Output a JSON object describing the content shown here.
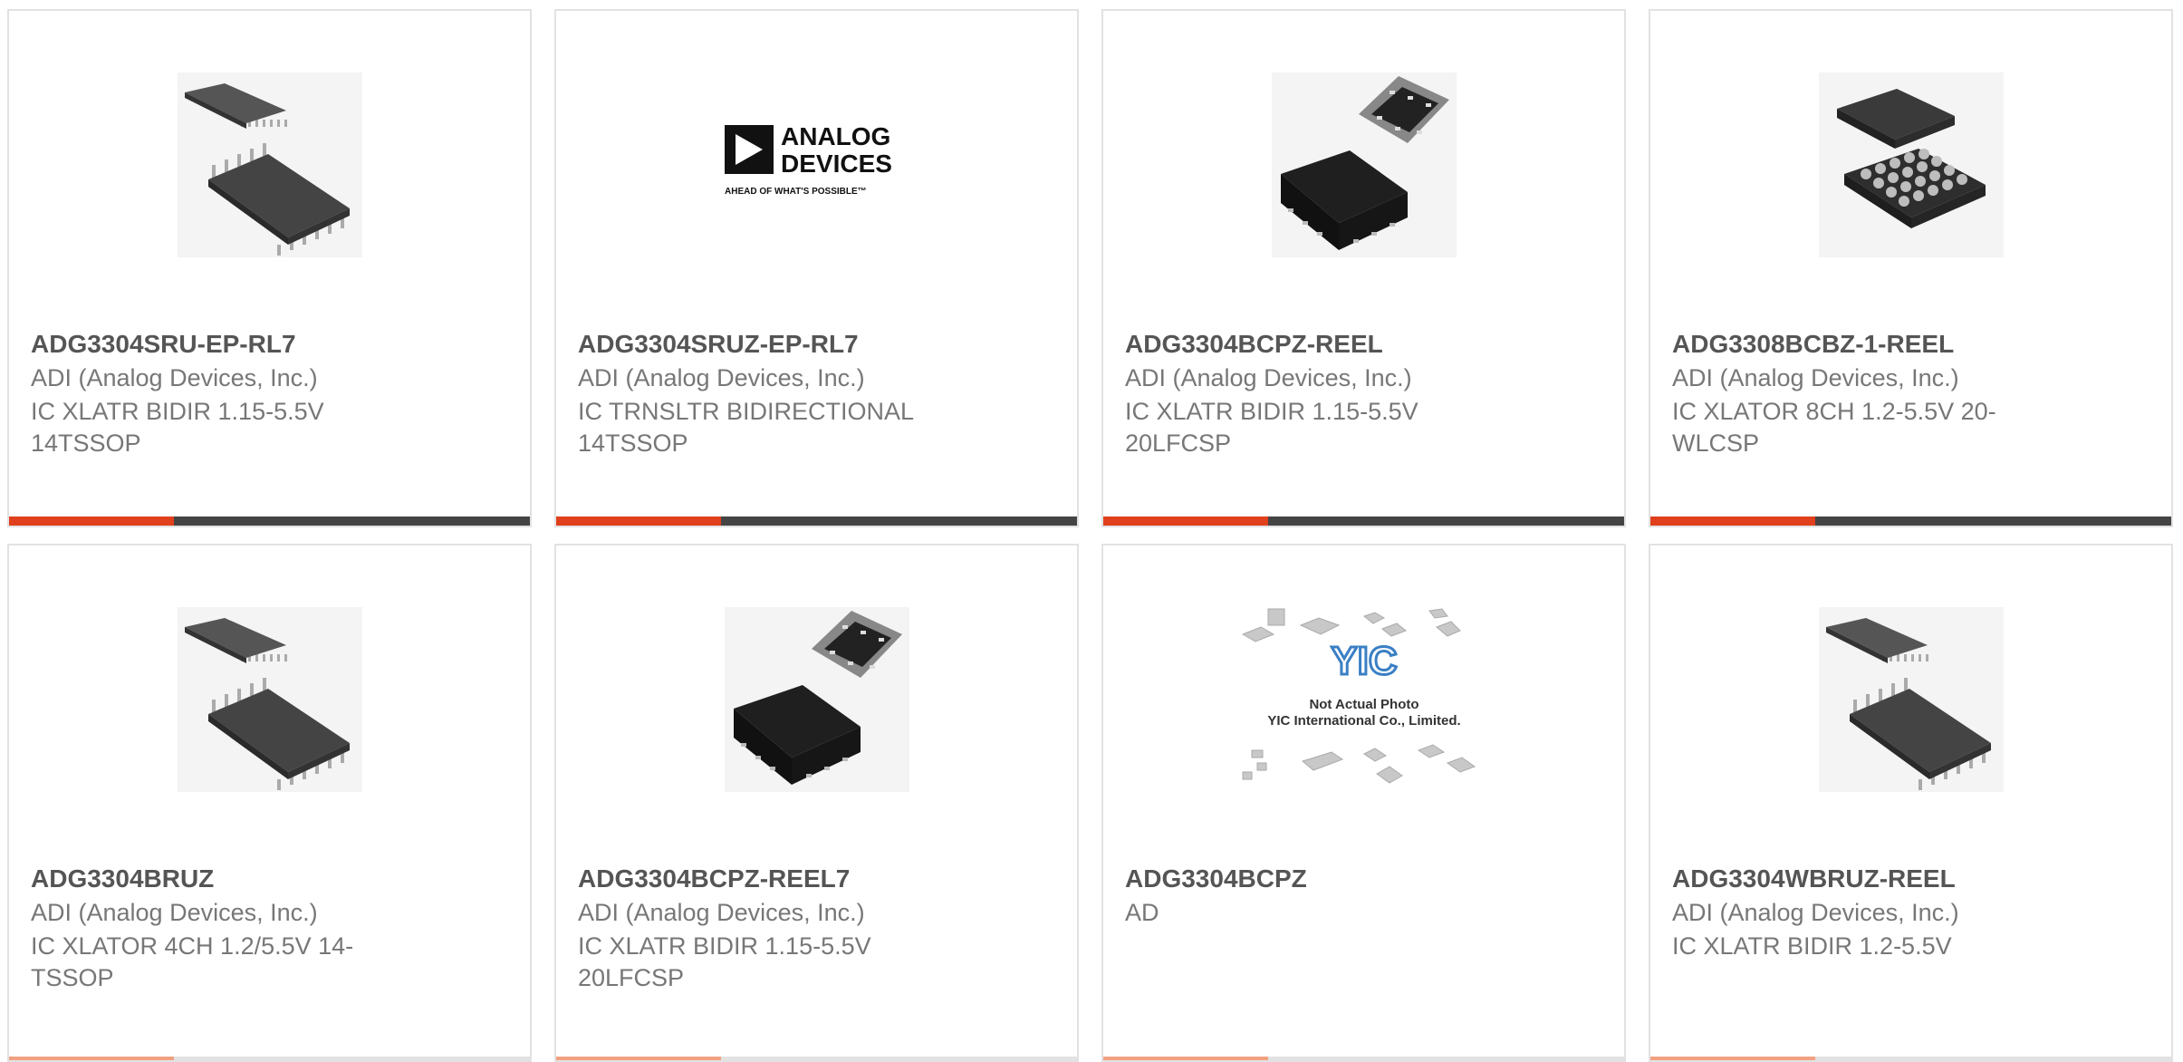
{
  "products": [
    {
      "part": "ADG3304SRU-EP-RL7",
      "manufacturer": "ADI (Analog Devices, Inc.)",
      "description": "IC XLATR BIDIR 1.15-5.5V 14TSSOP",
      "image": "tssop-chip-photo"
    },
    {
      "part": "ADG3304SRUZ-EP-RL7",
      "manufacturer": "ADI (Analog Devices, Inc.)",
      "description": "IC TRNSLTR BIDIRECTIONAL 14TSSOP",
      "image": "analog-devices-logo",
      "logo_text": {
        "line1": "ANALOG",
        "line2": "DEVICES",
        "tagline": "AHEAD OF WHAT'S POSSIBLE™"
      }
    },
    {
      "part": "ADG3304BCPZ-REEL",
      "manufacturer": "ADI (Analog Devices, Inc.)",
      "description": "IC XLATR BIDIR 1.15-5.5V 20LFCSP",
      "image": "lfcsp-chip-photo"
    },
    {
      "part": "ADG3308BCBZ-1-REEL",
      "manufacturer": "ADI (Analog Devices, Inc.)",
      "description": "IC XLATOR 8CH 1.2-5.5V 20-WLCSP",
      "image": "wlcsp-chip-photo"
    },
    {
      "part": "ADG3304BRUZ",
      "manufacturer": "ADI (Analog Devices, Inc.)",
      "description": "IC XLATOR 4CH 1.2/5.5V 14-TSSOP",
      "image": "tssop-chip-photo"
    },
    {
      "part": "ADG3304BCPZ-REEL7",
      "manufacturer": "ADI (Analog Devices, Inc.)",
      "description": "IC XLATR BIDIR 1.15-5.5V 20LFCSP",
      "image": "lfcsp-chip-photo"
    },
    {
      "part": "ADG3304BCPZ",
      "manufacturer": "AD",
      "description": "",
      "image": "not-actual-photo",
      "placeholder_text": {
        "logo": "YIC",
        "line1": "Not Actual Photo",
        "line2": "YIC International Co., Limited."
      }
    },
    {
      "part": "ADG3304WBRUZ-REEL",
      "manufacturer": "ADI (Analog Devices, Inc.)",
      "description": "IC XLATR BIDIR 1.2-5.5V",
      "image": "tssop-chip-photo"
    }
  ],
  "colors": {
    "accent": "#e0401c",
    "bar": "#444444",
    "border": "#e2e2e2",
    "title": "#555555",
    "text": "#777777"
  }
}
